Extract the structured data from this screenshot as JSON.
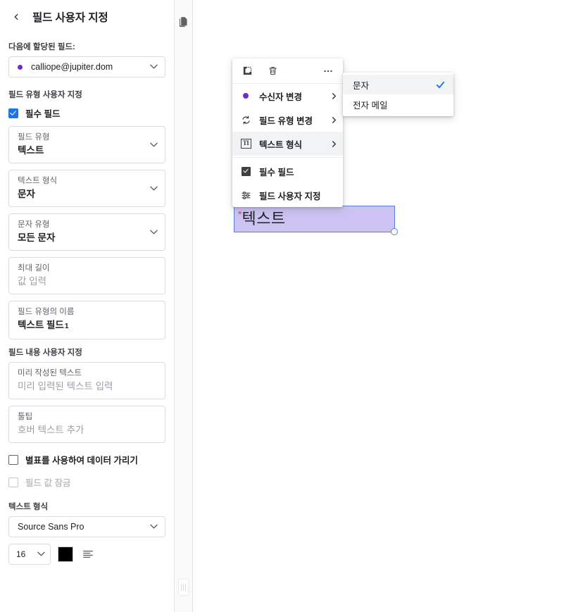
{
  "sidebar": {
    "back_icon": "chevron-left-icon",
    "title": "필드 사용자 지정",
    "assigned_label": "다음에 할당된 필드:",
    "assigned_value": "calliope@jupiter.dom",
    "assigned_dot_color": "#7229d4",
    "field_type_section_label": "필드 유형 사용자 지정",
    "required_checkbox": {
      "label": "필수 필드",
      "checked": true,
      "accent": "#1a73e8"
    },
    "fields": [
      {
        "label": "필드 유형",
        "value": "텍스트",
        "type": "select"
      },
      {
        "label": "텍스트 형식",
        "value": "문자",
        "type": "select"
      },
      {
        "label": "문자 유형",
        "value": "모든 문자",
        "type": "select"
      },
      {
        "label": "최대 길이",
        "value": "값 입력",
        "type": "input",
        "is_placeholder": true
      },
      {
        "label": "필드 유형의 이름",
        "value": "텍스트 필드",
        "sup": "1",
        "type": "input"
      }
    ],
    "content_section_label": "필드 내용 사용자 지정",
    "content_fields": [
      {
        "label": "미리 작성된 텍스트",
        "value": "미리 입력된 텍스트 입력",
        "is_placeholder": true
      },
      {
        "label": "툴팁",
        "value": "호버 텍스트 추가",
        "is_placeholder": true
      }
    ],
    "mask_checkbox": {
      "label": "별표를 사용하여 데이터 가리기",
      "checked": false,
      "disabled": false
    },
    "lock_checkbox": {
      "label": "필드 값 잠금",
      "checked": false,
      "disabled": true
    },
    "text_format_label": "텍스트 형식",
    "font_family_value": "Source Sans Pro",
    "font_size_value": "16",
    "font_color": "#000000",
    "align_icon": "align-left-icon"
  },
  "divider": {
    "pages_icon": "pages-icon",
    "drag_handle_icon": "panel-resize-handle"
  },
  "context_menu": {
    "tools": [
      {
        "icon": "duplicate-icon",
        "name": "duplicate"
      },
      {
        "icon": "trash-icon",
        "name": "delete"
      },
      {
        "icon": "more-horizontal-icon",
        "name": "more-options"
      }
    ],
    "items": [
      {
        "icon": "purple-dot-icon",
        "label": "수신자 변경",
        "has_submenu": true,
        "active": false
      },
      {
        "icon": "sync-icon",
        "label": "필드 유형 변경",
        "has_submenu": true,
        "active": false
      },
      {
        "icon": "text-format-icon",
        "label": "텍스트 형식",
        "has_submenu": true,
        "active": true
      },
      {
        "icon": "checkbox-checked-icon",
        "label": "필수 필드",
        "has_submenu": false,
        "active": false
      },
      {
        "icon": "tune-icon",
        "label": "필드 사용자 지정",
        "has_submenu": false,
        "active": false
      }
    ]
  },
  "submenu": {
    "items": [
      {
        "label": "문자",
        "selected": true
      },
      {
        "label": "전자 메일",
        "selected": false
      }
    ],
    "check_color": "#1a73e8"
  },
  "text_widget": {
    "required_marker": "*",
    "text": "텍스트",
    "fill_color": "#ccc3f2",
    "border_color": "#5b7fd4",
    "marker_color": "#ea4335"
  }
}
